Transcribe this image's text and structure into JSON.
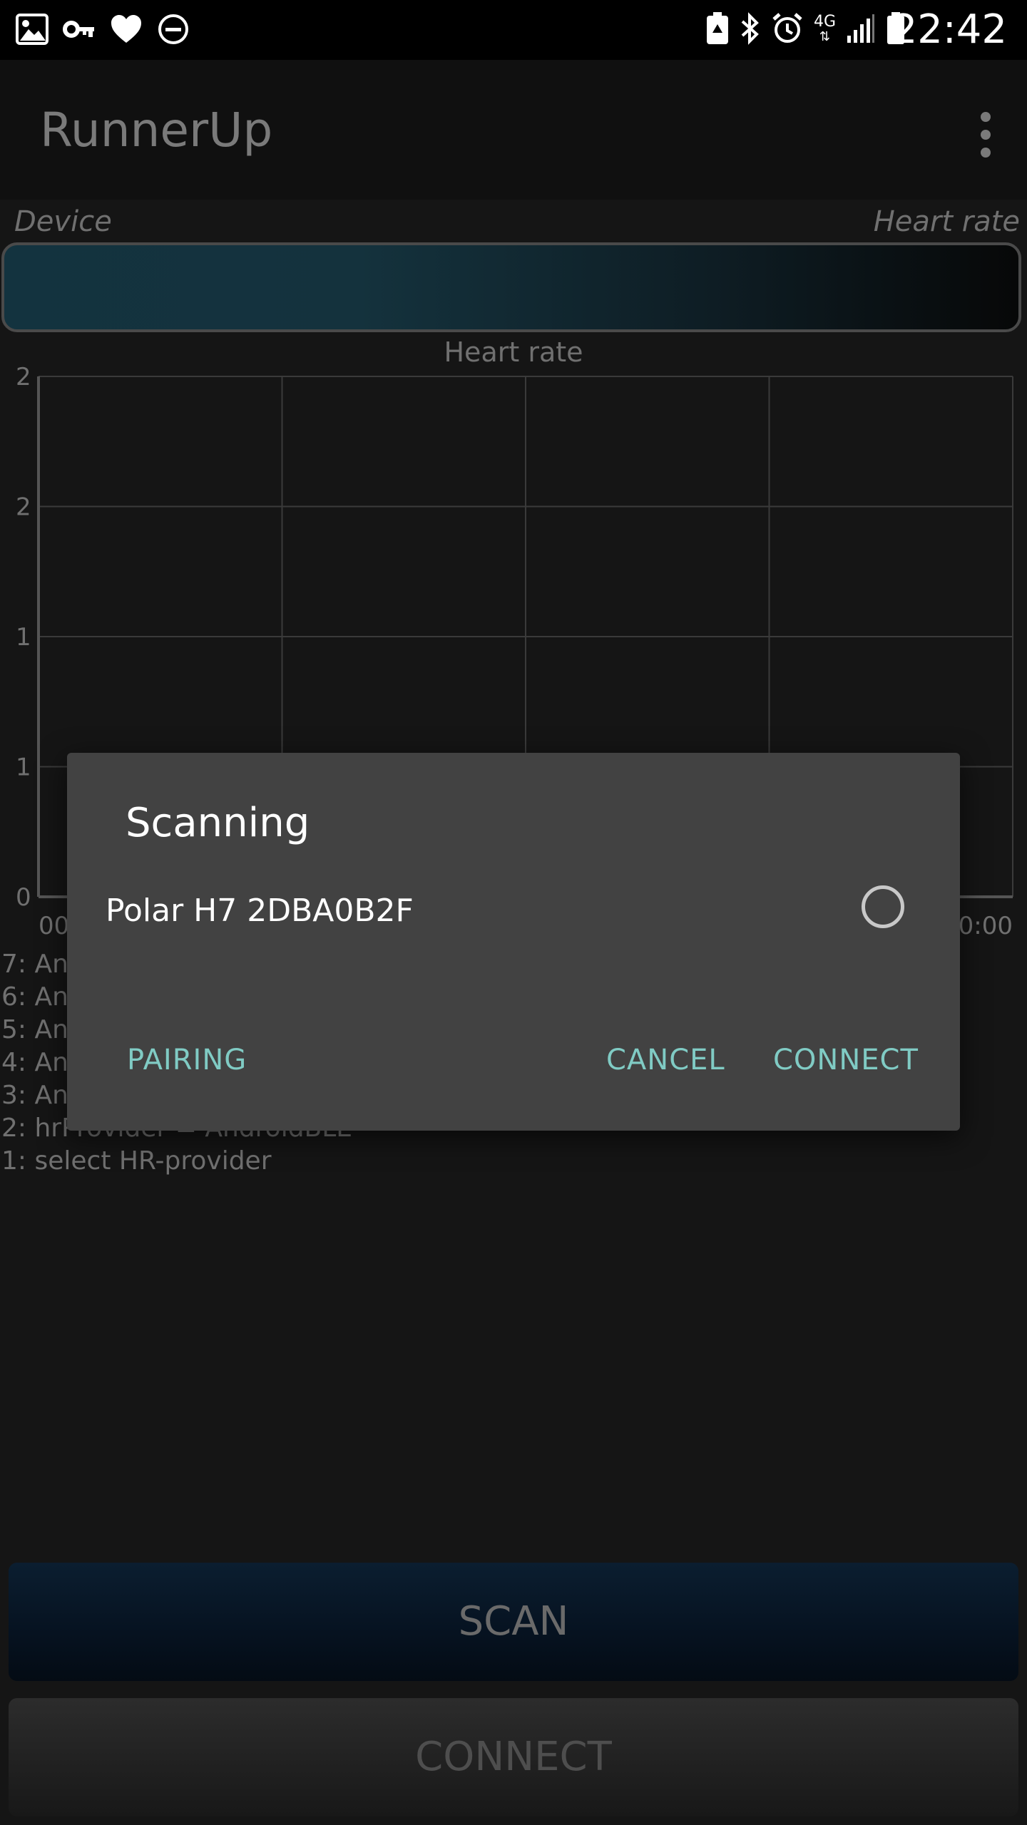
{
  "status_bar": {
    "time": "22:42",
    "network_label": "4G",
    "left_icons": [
      "image-icon",
      "key-icon",
      "heart-icon",
      "do-not-disturb-icon"
    ],
    "right_icons": [
      "battery-saver-icon",
      "bluetooth-icon",
      "alarm-icon",
      "network-4g-icon",
      "signal-icon",
      "battery-icon"
    ]
  },
  "app_bar": {
    "title": "RunnerUp",
    "menu_icon": "more-vert-icon"
  },
  "device_section": {
    "device_label": "Device",
    "heart_rate_label": "Heart rate"
  },
  "chart_data": {
    "type": "line",
    "title": "Heart rate",
    "y_tick_labels": [
      "2",
      "2",
      "1",
      "1",
      "0"
    ],
    "x_tick_labels": [
      "00",
      "0:00"
    ],
    "series": [],
    "grid": true
  },
  "log": {
    "lines": [
      "7: An",
      "6: An",
      "5: An",
      "4: An",
      "3: An",
      "2: hrProvider = AndroidBLE",
      "1: select HR-provider"
    ]
  },
  "buttons": {
    "scan": "SCAN",
    "connect": "CONNECT"
  },
  "dialog": {
    "title": "Scanning",
    "device_name": "Polar H7 2DBA0B2F",
    "device_selected": false,
    "pairing": "PAIRING",
    "cancel": "CANCEL",
    "connect": "CONNECT"
  },
  "colors": {
    "dialog_background": "#424242",
    "dialog_action": "#80cbc4",
    "screen_background": "#151515"
  }
}
